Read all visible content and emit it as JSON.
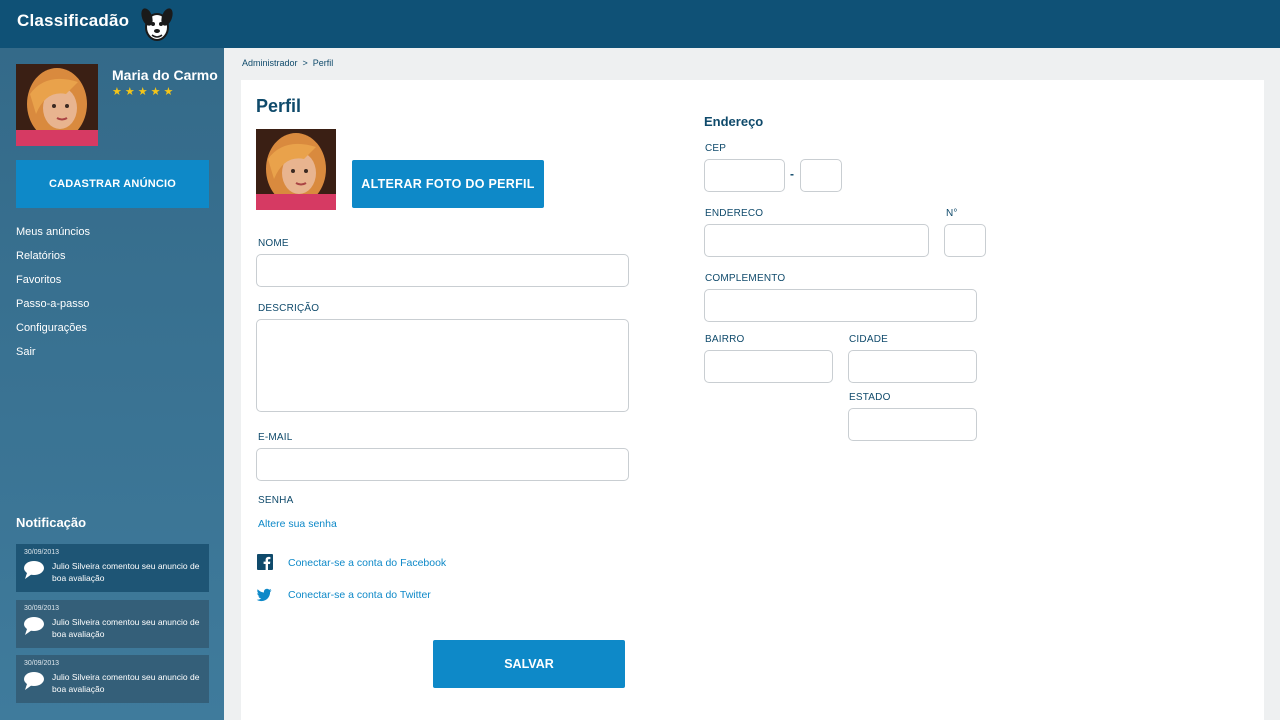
{
  "header": {
    "logo_text": "Classificadão",
    "logo_icon": "dog-mascot-icon"
  },
  "sidebar": {
    "user_name": "Maria do Carmo",
    "rating": 5,
    "stars_text": "★★★★★",
    "cta_label": "CADASTRAR ANÚNCIO",
    "menu": [
      "Meus anúncios",
      "Relatórios",
      "Favoritos",
      "Passo-a-passo",
      "Configurações",
      "Sair"
    ],
    "notifications_title": "Notificação",
    "notifications": [
      {
        "date": "30/09/2013",
        "text": "Julio Silveira comentou seu anuncio de boa avaliação"
      },
      {
        "date": "30/09/2013",
        "text": "Julio Silveira comentou seu anuncio de boa avaliação"
      },
      {
        "date": "30/09/2013",
        "text": "Julio Silveira comentou seu anuncio de boa avaliação"
      }
    ]
  },
  "breadcrumb": {
    "root": "Administrador",
    "separator": ">",
    "current": "Perfil"
  },
  "profile": {
    "title": "Perfil",
    "change_photo_label": "ALTERAR FOTO DO PERFIL",
    "labels": {
      "nome": "NOME",
      "descricao": "DESCRIÇÃO",
      "email": "E-MAIL",
      "senha": "SENHA"
    },
    "values": {
      "nome": "",
      "descricao": "",
      "email": ""
    },
    "change_password_link": "Altere sua senha",
    "facebook_link": "Conectar-se a conta do Facebook",
    "twitter_link": "Conectar-se a conta do Twitter",
    "save_label": "SALVAR"
  },
  "address": {
    "title": "Endereço",
    "labels": {
      "cep": "CEP",
      "endereco": "ENDERECO",
      "numero": "N°",
      "complemento": "COMPLEMENTO",
      "bairro": "BAIRRO",
      "cidade": "CIDADE",
      "estado": "ESTADO"
    },
    "cep_separator": "-",
    "values": {
      "cep1": "",
      "cep2": "",
      "endereco": "",
      "numero": "",
      "complemento": "",
      "bairro": "",
      "cidade": "",
      "estado": ""
    }
  },
  "colors": {
    "header": "#0f5176",
    "accent": "#0e89c8",
    "text": "#0f4a6b",
    "sidebar": "#3a7495",
    "star": "#f5c518"
  }
}
